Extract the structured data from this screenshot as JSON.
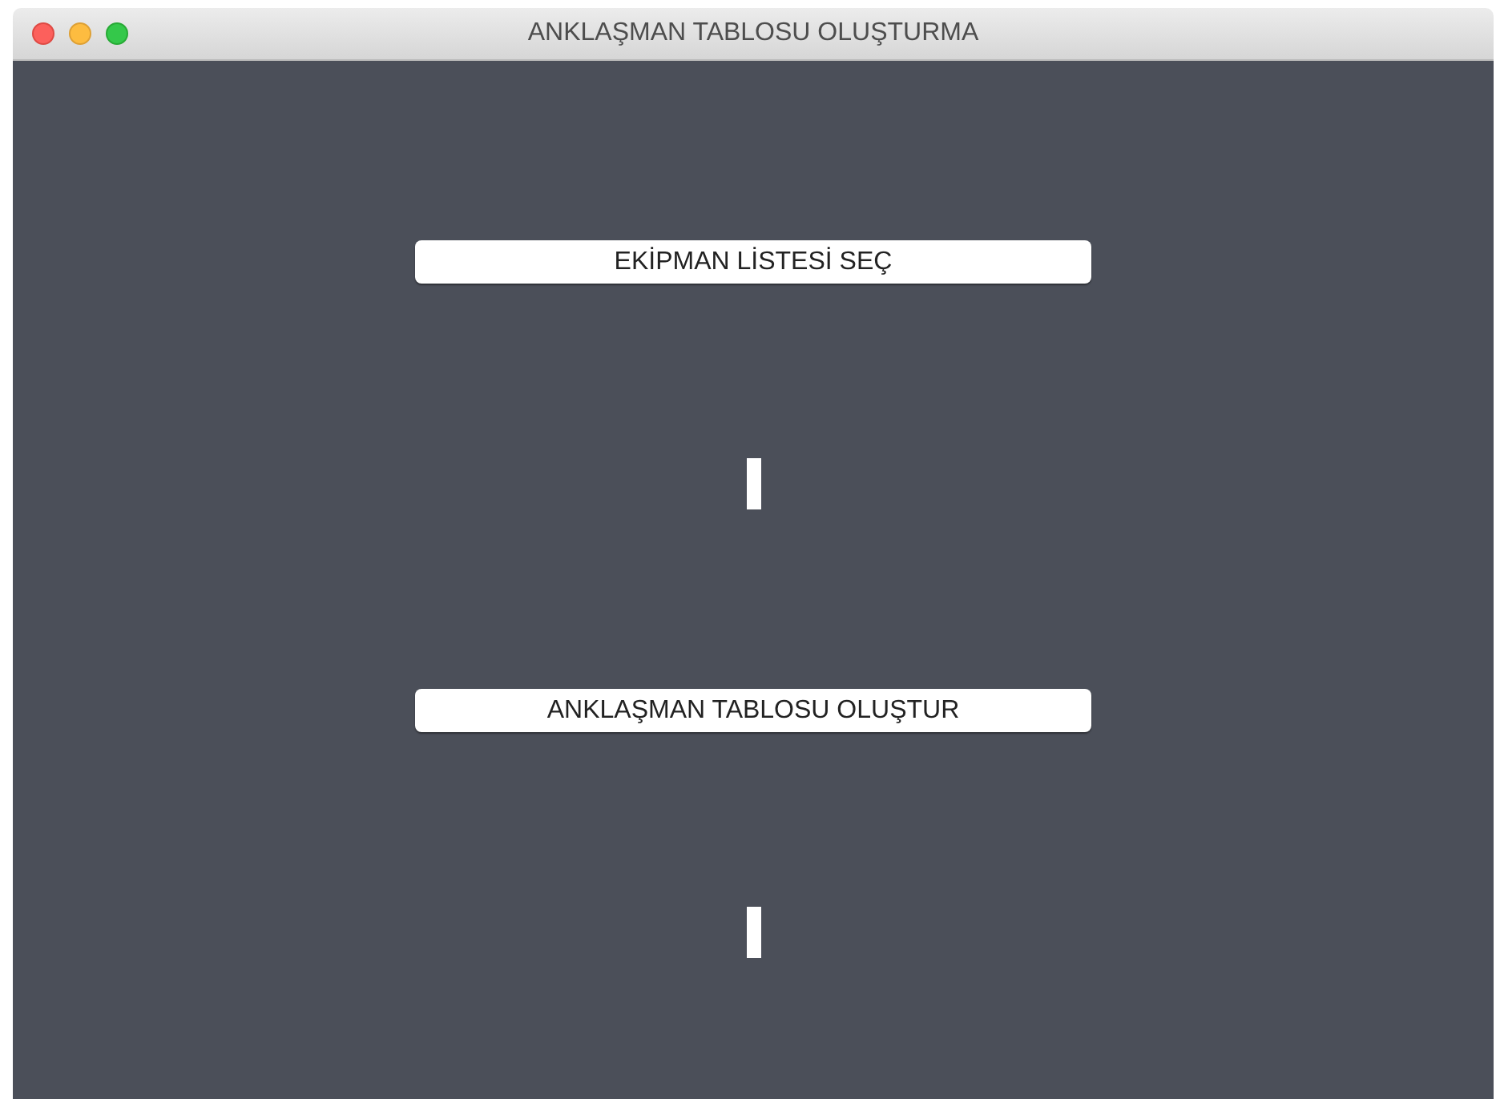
{
  "window": {
    "title": "ANKLAŞMAN TABLOSU OLUŞTURMA"
  },
  "buttons": [
    {
      "label": "EKİPMAN LİSTESİ SEÇ"
    },
    {
      "label": "ANKLAŞMAN TABLOSU OLUŞTUR"
    }
  ]
}
